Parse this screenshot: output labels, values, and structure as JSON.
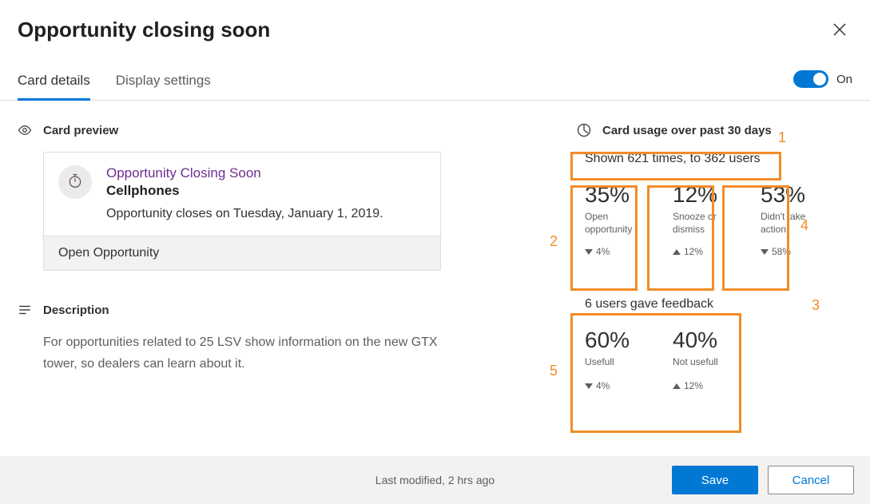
{
  "header": {
    "title": "Opportunity closing soon"
  },
  "tabs": {
    "card_details": "Card details",
    "display_settings": "Display settings"
  },
  "toggle": {
    "label": "On"
  },
  "preview": {
    "section_title": "Card preview",
    "card_title": "Opportunity Closing Soon",
    "card_subtitle": "Cellphones",
    "card_desc": "Opportunity closes on Tuesday, January 1, 2019.",
    "action_label": "Open Opportunity"
  },
  "description": {
    "section_title": "Description",
    "text": "For opportunities related to 25 LSV show information on the new GTX tower, so dealers can learn about it."
  },
  "usage": {
    "section_title": "Card usage over past 30 days",
    "shown_line": "Shown 621 times, to 362 users",
    "stats": [
      {
        "value": "35%",
        "label": "Open opportunity",
        "delta_dir": "down",
        "delta": "4%"
      },
      {
        "value": "12%",
        "label": "Snooze or dismiss",
        "delta_dir": "up",
        "delta": "12%"
      },
      {
        "value": "53%",
        "label": "Didn't take action",
        "delta_dir": "down",
        "delta": "58%"
      }
    ],
    "feedback_line": "6 users gave feedback",
    "feedback_stats": [
      {
        "value": "60%",
        "label": "Usefull",
        "delta_dir": "down",
        "delta": "4%"
      },
      {
        "value": "40%",
        "label": "Not usefull",
        "delta_dir": "up",
        "delta": "12%"
      }
    ]
  },
  "annotations": {
    "n1": "1",
    "n2": "2",
    "n3": "3",
    "n4": "4",
    "n5": "5"
  },
  "footer": {
    "modified": "Last modified, 2 hrs ago",
    "save": "Save",
    "cancel": "Cancel"
  }
}
